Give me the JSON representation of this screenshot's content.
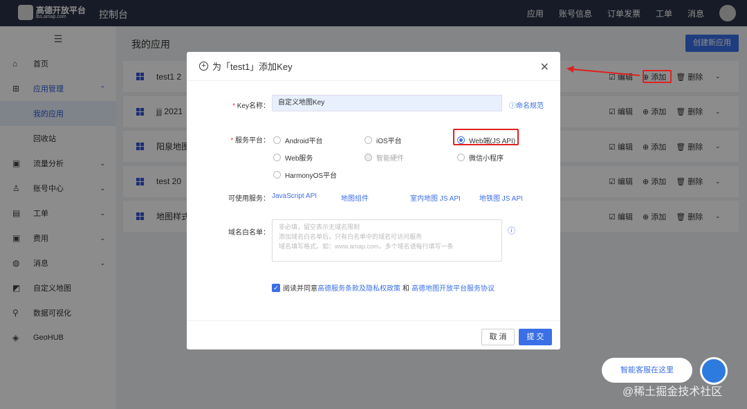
{
  "topbar": {
    "logo_title": "高德开放平台",
    "logo_sub": "lbs.amap.com",
    "console": "控制台",
    "nav": [
      "应用",
      "账号信息",
      "订单发票",
      "工单",
      "消息"
    ]
  },
  "sidebar": {
    "menu_icon": "☰",
    "items": [
      {
        "icon": "⌂",
        "label": "首页"
      },
      {
        "icon": "⊞",
        "label": "应用管理",
        "chev": "⌃"
      },
      {
        "label": "我的应用"
      },
      {
        "label": "回收站"
      },
      {
        "icon": "▣",
        "label": "流量分析",
        "chev": "⌄"
      },
      {
        "icon": "♙",
        "label": "账号中心",
        "chev": "⌄"
      },
      {
        "icon": "▤",
        "label": "工单",
        "chev": "⌄"
      },
      {
        "icon": "▣",
        "label": "费用",
        "chev": "⌄"
      },
      {
        "icon": "◍",
        "label": "消息",
        "chev": "⌄"
      },
      {
        "icon": "◩",
        "label": "自定义地图"
      },
      {
        "icon": "⚲",
        "label": "数据可视化"
      },
      {
        "icon": "◈",
        "label": "GeoHUB"
      }
    ]
  },
  "main": {
    "title": "我的应用",
    "new_button": "创建新应用",
    "apps": [
      {
        "name": "test1  2"
      },
      {
        "name": "jjj  2021"
      },
      {
        "name": "阳泉地图"
      },
      {
        "name": "test  20"
      },
      {
        "name": "地图样式"
      }
    ],
    "actions": {
      "edit": "编辑",
      "add": "添加",
      "delete": "删除"
    }
  },
  "modal": {
    "title": "为「test1」添加Key",
    "key_label": "Key名称：",
    "key_value": "自定义地图Key",
    "naming_link": "命名规范",
    "platform_label": "服务平台：",
    "platforms": [
      "Android平台",
      "iOS平台",
      "Web端(JS API)",
      "Web服务",
      "智能硬件",
      "微信小程序",
      "HarmonyOS平台"
    ],
    "services_label": "可使用服务：",
    "services": [
      "JavaScript API",
      "地图组件",
      "室内地图 JS API",
      "地铁图 JS API"
    ],
    "whitelist_label": "域名白名单：",
    "whitelist_placeholder": "非必填，留空表示无域名限制\n添加域名白名单后，只有白名单中的域名可访问服务\n域名填写格式，如：www.amap.com，多个域名请每行填写一条",
    "agree_text": "阅读并同意",
    "agree_link1": "高德服务条款及隐私权政策",
    "agree_and": "和",
    "agree_link2": "高德地图开放平台服务协议",
    "cancel": "取 消",
    "submit": "提 交"
  },
  "chat": {
    "label": "智能客服在这里"
  },
  "watermark": "@稀土掘金技术社区"
}
